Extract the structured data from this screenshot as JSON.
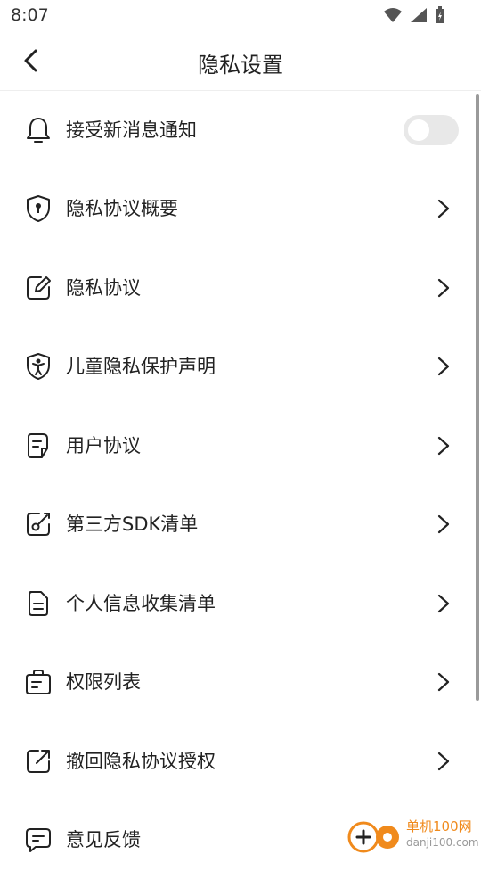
{
  "status": {
    "time": "8:07"
  },
  "nav": {
    "title": "隐私设置"
  },
  "items": [
    {
      "label": "接受新消息通知",
      "icon": "bell-icon",
      "type": "toggle",
      "toggle_on": false
    },
    {
      "label": "隐私协议概要",
      "icon": "shield-keyhole-icon",
      "type": "link"
    },
    {
      "label": "隐私协议",
      "icon": "edit-note-icon",
      "type": "link"
    },
    {
      "label": "儿童隐私保护声明",
      "icon": "child-shield-icon",
      "type": "link"
    },
    {
      "label": "用户协议",
      "icon": "document-icon",
      "type": "link"
    },
    {
      "label": "第三方SDK清单",
      "icon": "link-edit-icon",
      "type": "link"
    },
    {
      "label": "个人信息收集清单",
      "icon": "file-list-icon",
      "type": "link"
    },
    {
      "label": "权限列表",
      "icon": "bag-list-icon",
      "type": "link"
    },
    {
      "label": "撤回隐私协议授权",
      "icon": "external-share-icon",
      "type": "link"
    },
    {
      "label": "意见反馈",
      "icon": "chat-feedback-icon",
      "type": "link"
    }
  ],
  "watermark": {
    "text": "单机100网",
    "sub": "danji100.com"
  },
  "colors": {
    "text": "#222222",
    "divider": "#eeeeee",
    "toggle_off": "#e8e8e8",
    "watermark": "#f08a1c"
  }
}
